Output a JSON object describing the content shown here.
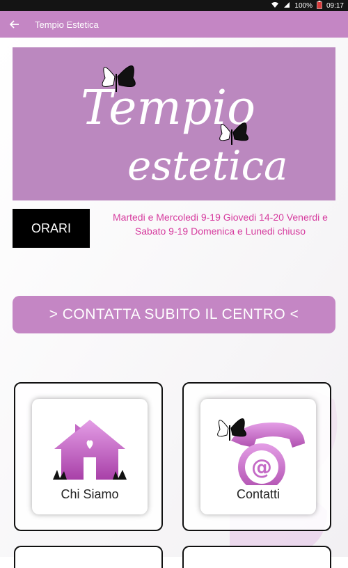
{
  "status_bar": {
    "battery": "100%",
    "time": "09:17"
  },
  "app_bar": {
    "title": "Tempio Estetica"
  },
  "logo": {
    "line1": "Tempio",
    "line2": "estetica"
  },
  "hours_section": {
    "button_label": "ORARI",
    "text": "Martedi e Mercoledi 9-19 Giovedi 14-20 Venerdi e Sabato 9-19 Domenica e Lunedi chiuso"
  },
  "cta": {
    "label": "> CONTATTA SUBITO IL CENTRO <"
  },
  "tiles": [
    {
      "label": "Chi Siamo",
      "icon": "house-heart-icon"
    },
    {
      "label": "Contatti",
      "icon": "phone-at-icon"
    }
  ],
  "colors": {
    "brand": "#c486c4",
    "accent_text": "#d63b9e"
  }
}
